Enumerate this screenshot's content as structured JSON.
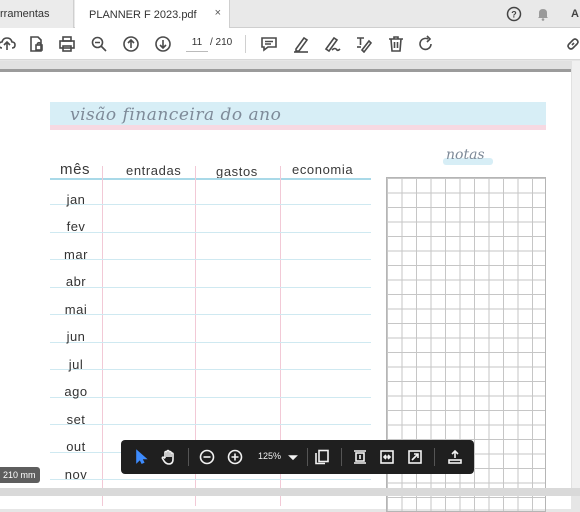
{
  "tabs": {
    "tools_label": "rramentas",
    "doc_label": "PLANNER F 2023.pdf",
    "close_glyph": "×"
  },
  "toolbar": {
    "page_current": "11",
    "page_total": "/ 210",
    "right_icon": "A"
  },
  "planner": {
    "title": "visão financeira do ano",
    "columns": [
      "mês",
      "entradas",
      "gastos",
      "economia"
    ],
    "months": [
      "jan",
      "fev",
      "mar",
      "abr",
      "mai",
      "jun",
      "jul",
      "ago",
      "set",
      "out",
      "nov"
    ],
    "notes_label": "notas"
  },
  "floating_toolbar": {
    "zoom": "125%"
  },
  "page_size_badge": "210 mm",
  "colors": {
    "title_bg": "#d7eef6",
    "title_underline": "#f6d9e2",
    "column_divider": "#f2c9d6",
    "row_line": "#cfe9f1"
  }
}
